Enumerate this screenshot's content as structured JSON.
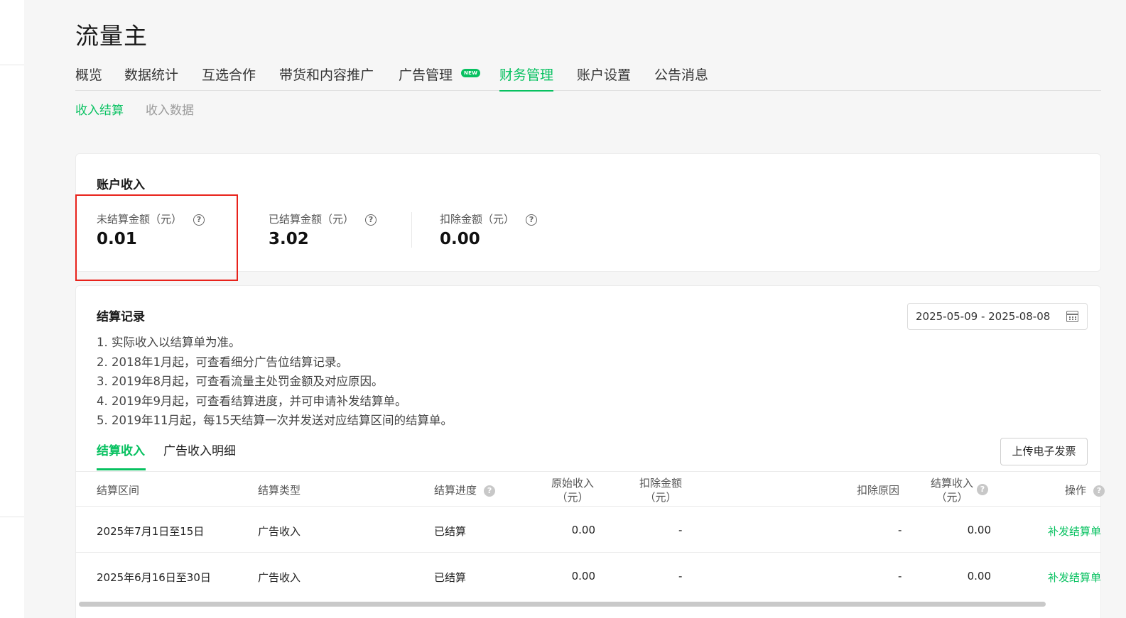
{
  "app": {
    "title": "流量主"
  },
  "main_nav": {
    "items": [
      {
        "label": "概览"
      },
      {
        "label": "数据统计"
      },
      {
        "label": "互选合作"
      },
      {
        "label": "带货和内容推广"
      },
      {
        "label": "广告管理",
        "badge": "NEW"
      },
      {
        "label": "财务管理",
        "active": true
      },
      {
        "label": "账户设置"
      },
      {
        "label": "公告消息"
      }
    ]
  },
  "sub_nav": {
    "items": [
      {
        "label": "收入结算",
        "active": true
      },
      {
        "label": "收入数据"
      }
    ]
  },
  "account_income": {
    "title": "账户收入",
    "stats": [
      {
        "label": "未结算金额（元）",
        "value": "0.01"
      },
      {
        "label": "已结算金额（元）",
        "value": "3.02"
      },
      {
        "label": "扣除金额（元）",
        "value": "0.00"
      }
    ]
  },
  "settlement": {
    "title": "结算记录",
    "notes": [
      "1. 实际收入以结算单为准。",
      "2. 2018年1月起，可查看细分广告位结算记录。",
      "3. 2019年8月起，可查看流量主处罚金额及对应原因。",
      "4. 2019年9月起，可查看结算进度，并可申请补发结算单。",
      "5. 2019年11月起，每15天结算一次并发送对应结算区间的结算单。"
    ],
    "date_range": "2025-05-09 - 2025-08-08",
    "tabs": [
      {
        "label": "结算收入",
        "active": true
      },
      {
        "label": "广告收入明细"
      }
    ],
    "upload_button": "上传电子发票",
    "columns": {
      "period": "结算区间",
      "type": "结算类型",
      "progress": "结算进度",
      "original_line1": "原始收入",
      "original_line2": "（元）",
      "deducted_line1": "扣除金额",
      "deducted_line2": "（元）",
      "reason": "扣除原因",
      "settled_line1": "结算收入",
      "settled_line2": "（元）",
      "action": "操作"
    },
    "rows": [
      {
        "period": "2025年7月1日至15日",
        "type": "广告收入",
        "progress": "已结算",
        "original": "0.00",
        "deducted": "-",
        "reason": "-",
        "settled": "0.00",
        "action": "补发结算单"
      },
      {
        "period": "2025年6月16日至30日",
        "type": "广告收入",
        "progress": "已结算",
        "original": "0.00",
        "deducted": "-",
        "reason": "-",
        "settled": "0.00",
        "action": "补发结算单"
      }
    ]
  },
  "colors": {
    "accent": "#07c160",
    "highlight": "#e8221b"
  }
}
